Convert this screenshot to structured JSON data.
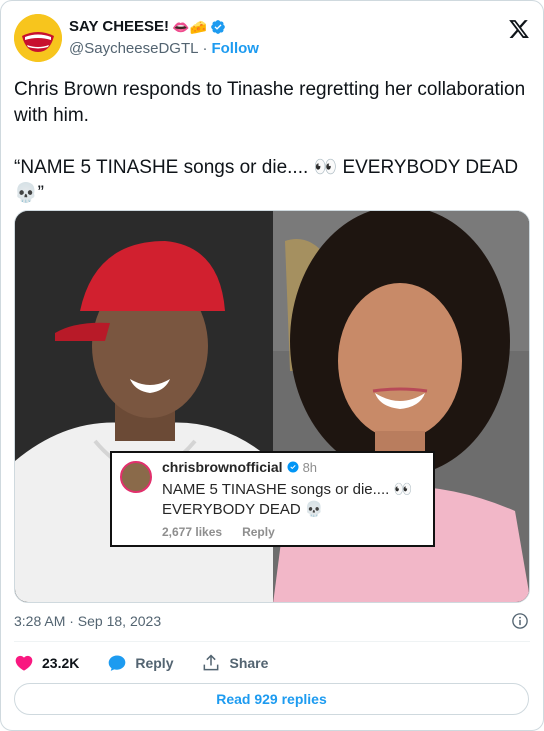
{
  "author": {
    "display_name": "SAY CHEESE!",
    "emoji": "👄🧀",
    "handle": "@SaycheeseDGTL",
    "separator": "·",
    "follow_label": "Follow"
  },
  "tweet": {
    "text": "Chris Brown responds to Tinashe regretting her collaboration with him.\n\n“NAME 5 TINASHE songs or die.... 👀 EVERYBODY DEAD 💀”",
    "timestamp": "3:28 AM · Sep 18, 2023"
  },
  "media": {
    "overlay": {
      "username": "chrisbrownofficial",
      "time": "8h",
      "comment": "NAME 5 TINASHE songs or die.... 👀 EVERYBODY DEAD 💀",
      "likes": "2,677 likes",
      "reply": "Reply"
    }
  },
  "actions": {
    "likes_count": "23.2K",
    "reply_label": "Reply",
    "share_label": "Share"
  },
  "read_replies_label": "Read 929 replies",
  "colors": {
    "accent": "#1d9bf0",
    "like": "#f91880",
    "text_secondary": "#536471"
  }
}
